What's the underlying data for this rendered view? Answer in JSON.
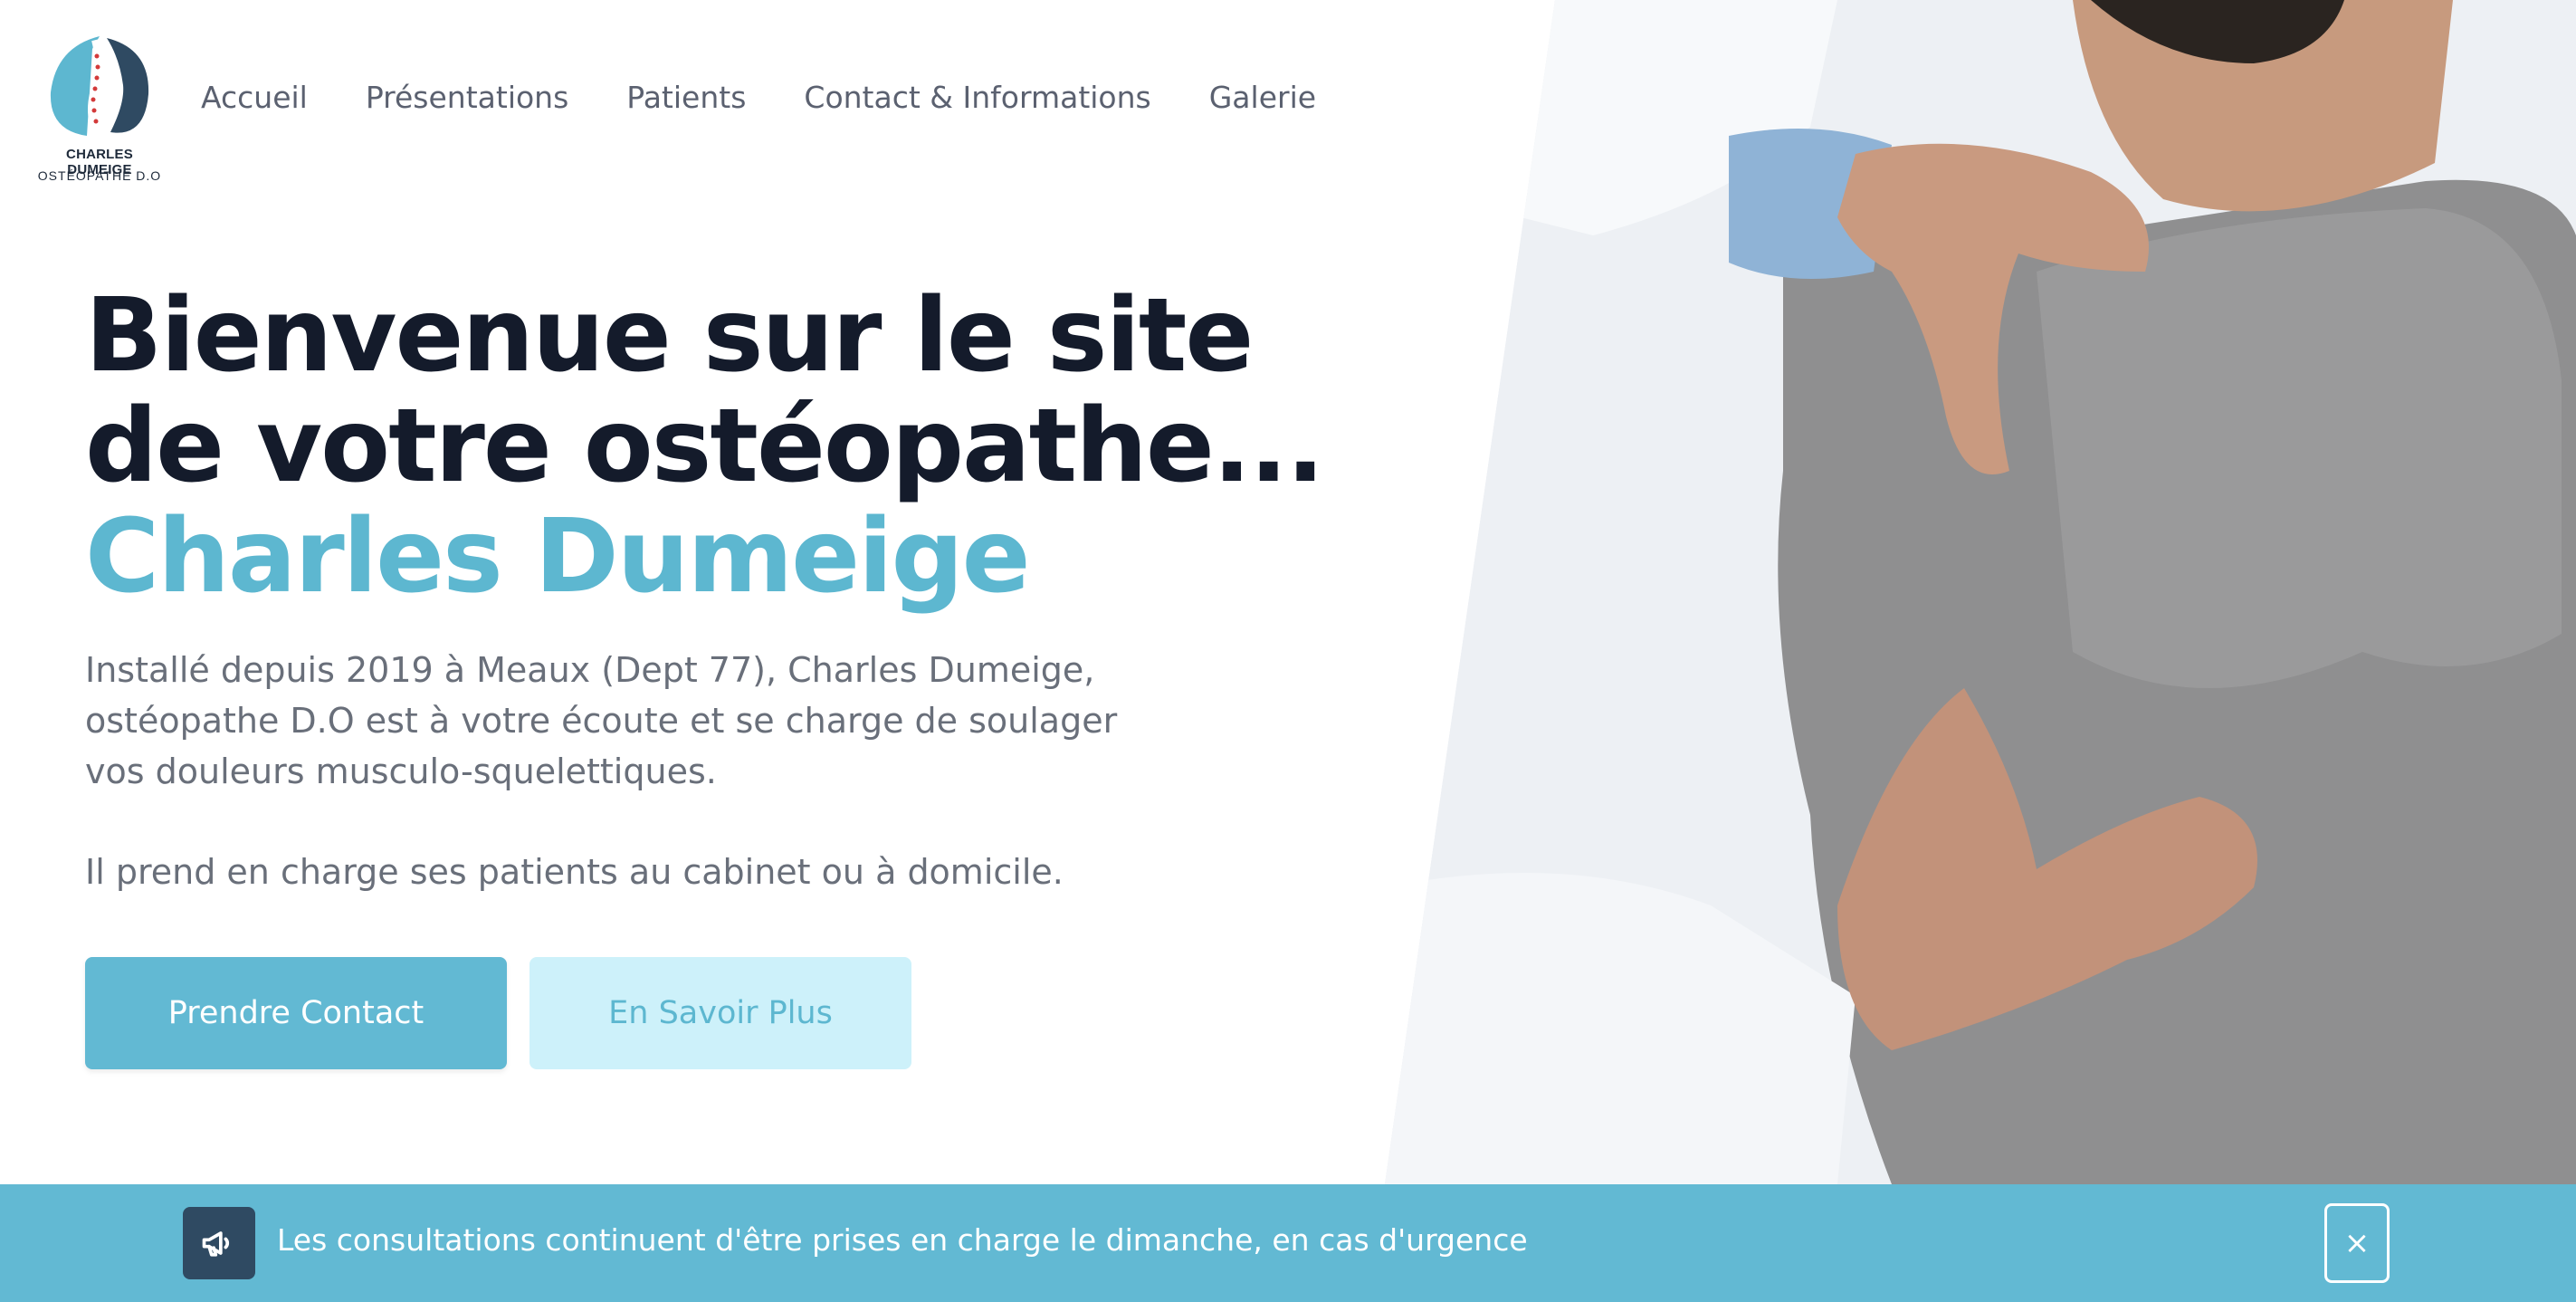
{
  "brand": {
    "name": "CHARLES DUMEIGE",
    "subtitle": "OSTÉOPATHE D.O",
    "accent_color": "#5db7d0",
    "dark_color": "#141b2b"
  },
  "nav": {
    "items": [
      {
        "label": "Accueil"
      },
      {
        "label": "Présentations"
      },
      {
        "label": "Patients"
      },
      {
        "label": "Contact & Informations"
      },
      {
        "label": "Galerie"
      }
    ]
  },
  "hero": {
    "title_line1": "Bienvenue sur le site",
    "title_line2": "de votre ostéopathe...",
    "title_name": "Charles Dumeige",
    "intro": "Installé depuis 2019 à Meaux (Dept 77), Charles Dumeige, ostéopathe D.O est à votre écoute et se charge de soulager vos douleurs musculo-squelettiques.",
    "intro2": "Il prend en charge ses patients au cabinet ou à domicile.",
    "primary_button": "Prendre Contact",
    "secondary_button": "En Savoir Plus",
    "image_icon": "osteopath-treatment-photo"
  },
  "banner": {
    "icon": "megaphone-icon",
    "text": "Les consultations continuent d'être prises en charge le dimanche, en cas d'urgence",
    "close_symbol": "×",
    "background": "#62b9d3"
  }
}
